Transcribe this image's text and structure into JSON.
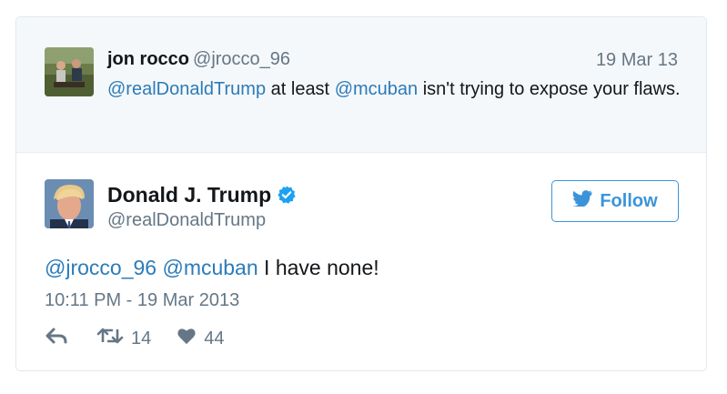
{
  "parent_tweet": {
    "name": "jon rocco",
    "handle": "@jrocco_96",
    "date": "19 Mar 13",
    "mention_1": "@realDonaldTrump",
    "text_1": " at least ",
    "mention_2": "@mcuban",
    "text_2": " isn't trying to expose your flaws."
  },
  "tweet": {
    "name": "Donald J. Trump",
    "handle": "@realDonaldTrump",
    "follow_label": "Follow",
    "mention_1": "@jrocco_96",
    "mention_2": "@mcuban",
    "text": " I have none!",
    "timestamp": "10:11 PM - 19 Mar 2013",
    "retweet_count": "14",
    "like_count": "44"
  },
  "colors": {
    "link": "#2b7bb9",
    "follow": "#3b94d9",
    "secondary": "#657786",
    "verified": "#1da1f2"
  },
  "icons": [
    "reply-icon",
    "retweet-icon",
    "like-icon",
    "verified-icon",
    "twitter-bird-icon"
  ]
}
